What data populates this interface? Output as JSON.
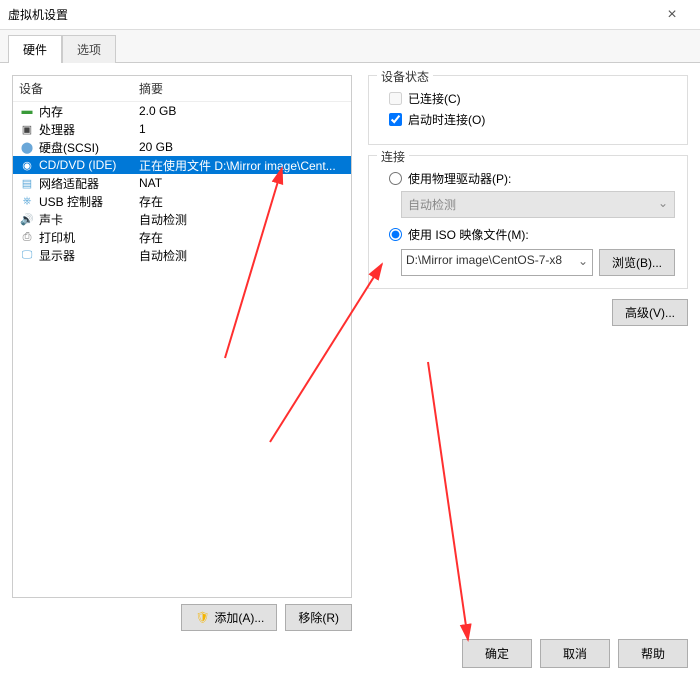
{
  "window": {
    "title": "虚拟机设置"
  },
  "tabs": {
    "hardware": "硬件",
    "options": "选项"
  },
  "device_table": {
    "col_device": "设备",
    "col_summary": "摘要",
    "rows": [
      {
        "icon": "memory-icon",
        "glyph": "▬",
        "color": "#3a9b3a",
        "name": "内存",
        "summary": "2.0 GB"
      },
      {
        "icon": "cpu-icon",
        "glyph": "▣",
        "color": "#444",
        "name": "处理器",
        "summary": "1"
      },
      {
        "icon": "disk-icon",
        "glyph": "⬤",
        "color": "#6aa7d8",
        "name": "硬盘(SCSI)",
        "summary": "20 GB"
      },
      {
        "icon": "cd-icon",
        "glyph": "◉",
        "color": "#ffffff",
        "name": "CD/DVD (IDE)",
        "summary": "正在使用文件 D:\\Mirror image\\Cent...",
        "selected": true
      },
      {
        "icon": "nic-icon",
        "glyph": "▤",
        "color": "#5aa7d8",
        "name": "网络适配器",
        "summary": "NAT"
      },
      {
        "icon": "usb-icon",
        "glyph": "⎈",
        "color": "#5aa7d8",
        "name": "USB 控制器",
        "summary": "存在"
      },
      {
        "icon": "sound-icon",
        "glyph": "🔊",
        "color": "#5aa7d8",
        "name": "声卡",
        "summary": "自动检测"
      },
      {
        "icon": "printer-icon",
        "glyph": "⎙",
        "color": "#777",
        "name": "打印机",
        "summary": "存在"
      },
      {
        "icon": "display-icon",
        "glyph": "🖵",
        "color": "#5aa7d8",
        "name": "显示器",
        "summary": "自动检测"
      }
    ]
  },
  "left_buttons": {
    "add": "添加(A)...",
    "remove": "移除(R)"
  },
  "status_group": {
    "title": "设备状态",
    "connected": "已连接(C)",
    "connect_at_power_on": "启动时连接(O)"
  },
  "connection_group": {
    "title": "连接",
    "physical": "使用物理驱动器(P):",
    "physical_value": "自动检测",
    "iso": "使用 ISO 映像文件(M):",
    "iso_path": "D:\\Mirror image\\CentOS-7-x8",
    "browse": "浏览(B)..."
  },
  "advanced": "高级(V)...",
  "footer": {
    "ok": "确定",
    "cancel": "取消",
    "help": "帮助"
  }
}
